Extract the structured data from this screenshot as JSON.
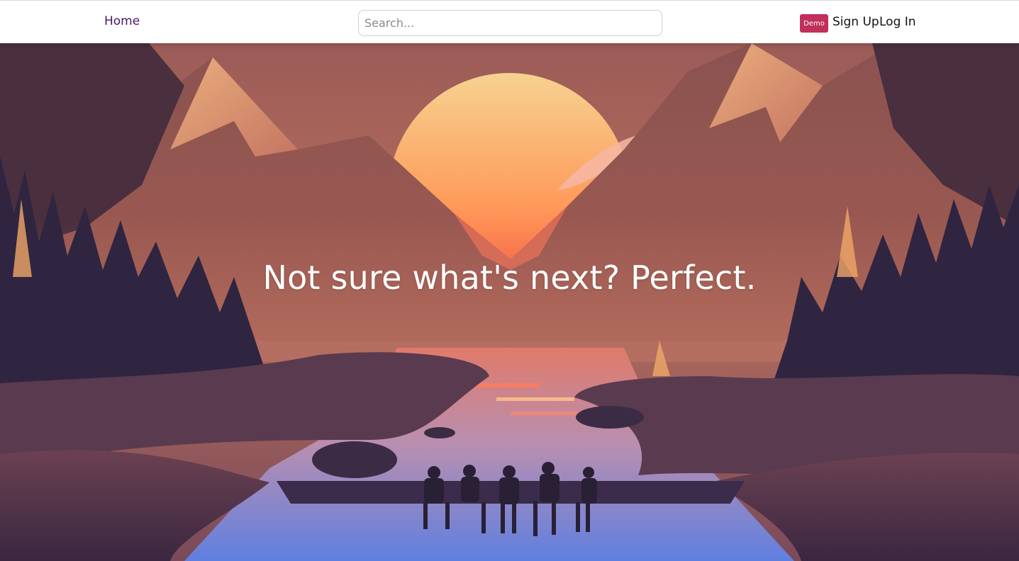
{
  "nav": {
    "home_label": "Home",
    "search_placeholder": "Search...",
    "search_value": "",
    "demo_label": "Demo",
    "signup_label": "Sign Up",
    "login_label": "Log In"
  },
  "hero": {
    "title": "Not sure what's next? Perfect.",
    "illustration_icon": "sunset-lake-illustration"
  },
  "colors": {
    "nav_link": "#4a1663",
    "demo_button": "#c0305a",
    "hero_text": "#ffffff",
    "sun_top": "#f7c98a",
    "sun_bottom": "#ff5b3a",
    "sky": "#b06a5a",
    "water": "#6f86d6"
  }
}
